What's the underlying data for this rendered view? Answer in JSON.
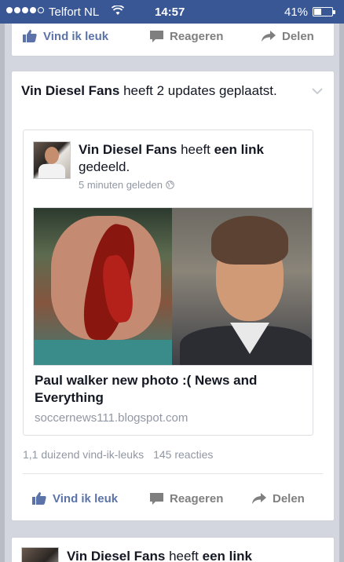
{
  "status_bar": {
    "carrier": "Telfort NL",
    "time": "14:57",
    "battery_percent": "41%",
    "battery_level": 0.41,
    "signal_bars": 4
  },
  "top_card": {
    "actions": {
      "like": "Vind ik leuk",
      "comment": "Reageren",
      "share": "Delen"
    }
  },
  "story": {
    "header_name": "Vin Diesel Fans",
    "header_text": " heeft 2 updates geplaatst.",
    "post": {
      "name": "Vin Diesel Fans",
      "text_part1": " heeft ",
      "text_bold": "een link",
      "text_part2": " gedeeld.",
      "time": "5 minuten geleden",
      "link_title": "Paul walker new photo :( News and Everything",
      "link_domain": "soccernews111.blogspot.com"
    },
    "likes": "1,1 duizend vind-ik-leuks",
    "comments": "145 reacties",
    "actions": {
      "like": "Vind ik leuk",
      "comment": "Reageren",
      "share": "Delen"
    }
  },
  "next_story": {
    "name": "Vin Diesel Fans",
    "text_part1": " heeft ",
    "text_bold": "een link"
  },
  "colors": {
    "status_bar": "#3a5795",
    "like_blue": "#5b73a8",
    "meta_gray": "#9197a3"
  }
}
